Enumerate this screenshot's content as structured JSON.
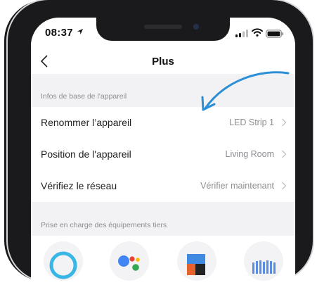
{
  "status": {
    "time": "08:37"
  },
  "nav": {
    "title": "Plus",
    "back_icon": "chevron-left-icon"
  },
  "section_basic": "Infos de base de l'appareil",
  "rows": [
    {
      "label": "Renommer l’appareil",
      "value": "LED Strip 1"
    },
    {
      "label": "Position de l'appareil",
      "value": "Living Room"
    },
    {
      "label": "Vérifiez le réseau",
      "value": "Vérifier maintenant"
    }
  ],
  "section_third": "Prise en charge des équipements tiers",
  "third_party": [
    {
      "name": "alexa-icon"
    },
    {
      "name": "google-assistant-icon"
    },
    {
      "name": "smartthings-icon"
    },
    {
      "name": "audio-wave-icon"
    }
  ],
  "colors": {
    "accent_arrow": "#2a8fd6",
    "background": "#f2f2f4",
    "card": "#ffffff"
  }
}
